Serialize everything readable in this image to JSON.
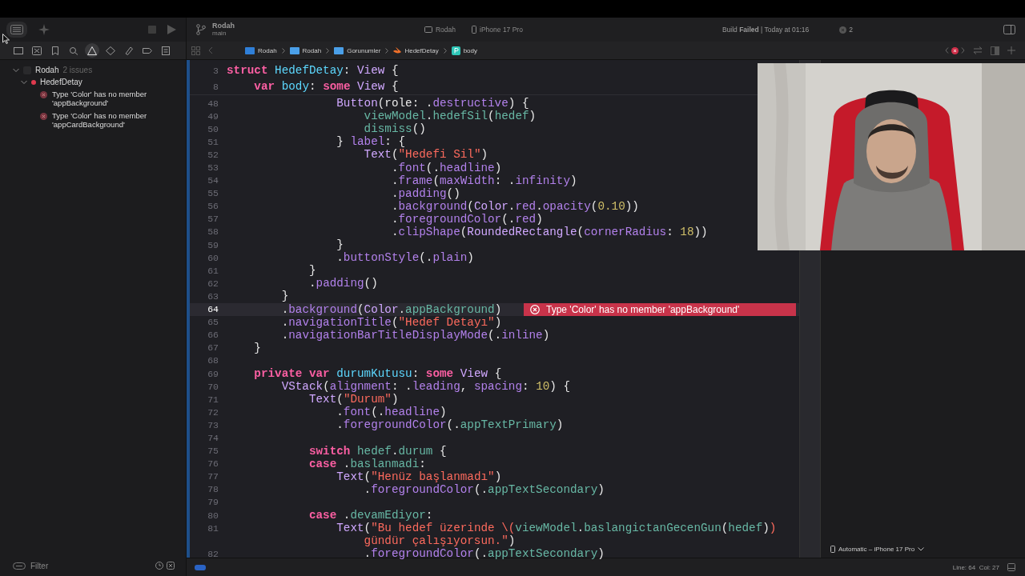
{
  "toolbar": {
    "project": "Rodah",
    "branch": "main",
    "scheme": "Rodah",
    "device": "iPhone 17 Pro",
    "status": "Build **Failed** | Today at 01:16",
    "issue_count": "2"
  },
  "navigator_tabs": [
    {
      "kind": "folder",
      "selected": false
    },
    {
      "kind": "source",
      "selected": false
    },
    {
      "kind": "bookmark",
      "selected": false
    },
    {
      "kind": "search",
      "selected": false
    },
    {
      "kind": "issue",
      "selected": true
    },
    {
      "kind": "test",
      "selected": false
    },
    {
      "kind": "debug",
      "selected": false
    },
    {
      "kind": "breakpoint",
      "selected": false
    },
    {
      "kind": "report",
      "selected": false
    }
  ],
  "navigator": {
    "project": "Rodah",
    "issues_label": "2 issues",
    "expanded": true,
    "files": [
      {
        "name": "HedefDetay",
        "expanded": true,
        "issues": [
          "Type 'Color' has no member 'appBackground'",
          "Type 'Color' has no member 'appCardBackground'"
        ]
      }
    ],
    "filter_placeholder": "Filter"
  },
  "jump_bar": [
    {
      "kind": "project",
      "label": "Rodah"
    },
    {
      "kind": "folder",
      "label": "Rodah"
    },
    {
      "kind": "folder",
      "label": "Gorunumler"
    },
    {
      "kind": "swift",
      "label": "HedefDetay"
    },
    {
      "kind": "property",
      "label": "body"
    }
  ],
  "editor": {
    "sticky_lines": [
      {
        "number": "3",
        "tokens": [
          {
            "kind": "keyword",
            "text": "struct"
          },
          {
            "kind": "decl",
            "text": " HedefDetay"
          },
          {
            "kind": "plain",
            "text": ": "
          },
          {
            "kind": "type",
            "text": "View"
          },
          {
            "kind": "plain",
            "text": " {"
          }
        ]
      },
      {
        "number": "8",
        "tokens": [
          {
            "kind": "keyword",
            "text": "    var"
          },
          {
            "kind": "decl",
            "text": " body"
          },
          {
            "kind": "plain",
            "text": ": "
          },
          {
            "kind": "keyword",
            "text": "some"
          },
          {
            "kind": "type",
            "text": " View"
          },
          {
            "kind": "plain",
            "text": " {"
          }
        ]
      }
    ],
    "lines": [
      {
        "number": "48",
        "current": false,
        "tokens": [
          {
            "kind": "type",
            "text": "                Button"
          },
          {
            "kind": "plain",
            "text": "(role: ."
          },
          {
            "kind": "call",
            "text": "destructive"
          },
          {
            "kind": "plain",
            "text": ") {"
          }
        ]
      },
      {
        "number": "49",
        "current": false,
        "tokens": [
          {
            "kind": "member",
            "text": "                    viewModel"
          },
          {
            "kind": "plain",
            "text": "."
          },
          {
            "kind": "member",
            "text": "hedefSil"
          },
          {
            "kind": "plain",
            "text": "("
          },
          {
            "kind": "member",
            "text": "hedef"
          },
          {
            "kind": "plain",
            "text": ")"
          }
        ]
      },
      {
        "number": "50",
        "current": false,
        "tokens": [
          {
            "kind": "member",
            "text": "                    dismiss"
          },
          {
            "kind": "plain",
            "text": "()"
          }
        ]
      },
      {
        "number": "51",
        "current": false,
        "tokens": [
          {
            "kind": "plain",
            "text": "                } "
          },
          {
            "kind": "call",
            "text": "label"
          },
          {
            "kind": "plain",
            "text": ": {"
          }
        ]
      },
      {
        "number": "52",
        "current": false,
        "tokens": [
          {
            "kind": "type",
            "text": "                    Text"
          },
          {
            "kind": "plain",
            "text": "("
          },
          {
            "kind": "string",
            "text": "\"Hedefi Sil\""
          },
          {
            "kind": "plain",
            "text": ")"
          }
        ]
      },
      {
        "number": "53",
        "current": false,
        "tokens": [
          {
            "kind": "plain",
            "text": "                        ."
          },
          {
            "kind": "call",
            "text": "font"
          },
          {
            "kind": "plain",
            "text": "(."
          },
          {
            "kind": "call",
            "text": "headline"
          },
          {
            "kind": "plain",
            "text": ")"
          }
        ]
      },
      {
        "number": "54",
        "current": false,
        "tokens": [
          {
            "kind": "plain",
            "text": "                        ."
          },
          {
            "kind": "call",
            "text": "frame"
          },
          {
            "kind": "plain",
            "text": "("
          },
          {
            "kind": "call",
            "text": "maxWidth"
          },
          {
            "kind": "plain",
            "text": ": ."
          },
          {
            "kind": "call",
            "text": "infinity"
          },
          {
            "kind": "plain",
            "text": ")"
          }
        ]
      },
      {
        "number": "55",
        "current": false,
        "tokens": [
          {
            "kind": "plain",
            "text": "                        ."
          },
          {
            "kind": "call",
            "text": "padding"
          },
          {
            "kind": "plain",
            "text": "()"
          }
        ]
      },
      {
        "number": "56",
        "current": false,
        "tokens": [
          {
            "kind": "plain",
            "text": "                        ."
          },
          {
            "kind": "call",
            "text": "background"
          },
          {
            "kind": "plain",
            "text": "("
          },
          {
            "kind": "type",
            "text": "Color"
          },
          {
            "kind": "plain",
            "text": "."
          },
          {
            "kind": "call",
            "text": "red"
          },
          {
            "kind": "plain",
            "text": "."
          },
          {
            "kind": "call",
            "text": "opacity"
          },
          {
            "kind": "plain",
            "text": "("
          },
          {
            "kind": "number",
            "text": "0.10"
          },
          {
            "kind": "plain",
            "text": "))"
          }
        ]
      },
      {
        "number": "57",
        "current": false,
        "tokens": [
          {
            "kind": "plain",
            "text": "                        ."
          },
          {
            "kind": "call",
            "text": "foregroundColor"
          },
          {
            "kind": "plain",
            "text": "(."
          },
          {
            "kind": "call",
            "text": "red"
          },
          {
            "kind": "plain",
            "text": ")"
          }
        ]
      },
      {
        "number": "58",
        "current": false,
        "tokens": [
          {
            "kind": "plain",
            "text": "                        ."
          },
          {
            "kind": "call",
            "text": "clipShape"
          },
          {
            "kind": "plain",
            "text": "("
          },
          {
            "kind": "type",
            "text": "RoundedRectangle"
          },
          {
            "kind": "plain",
            "text": "("
          },
          {
            "kind": "call",
            "text": "cornerRadius"
          },
          {
            "kind": "plain",
            "text": ": "
          },
          {
            "kind": "number",
            "text": "18"
          },
          {
            "kind": "plain",
            "text": "))"
          }
        ]
      },
      {
        "number": "59",
        "current": false,
        "tokens": [
          {
            "kind": "plain",
            "text": "                }"
          }
        ]
      },
      {
        "number": "60",
        "current": false,
        "tokens": [
          {
            "kind": "plain",
            "text": "                ."
          },
          {
            "kind": "call",
            "text": "buttonStyle"
          },
          {
            "kind": "plain",
            "text": "(."
          },
          {
            "kind": "call",
            "text": "plain"
          },
          {
            "kind": "plain",
            "text": ")"
          }
        ]
      },
      {
        "number": "61",
        "current": false,
        "tokens": [
          {
            "kind": "plain",
            "text": "            }"
          }
        ]
      },
      {
        "number": "62",
        "current": false,
        "tokens": [
          {
            "kind": "plain",
            "text": "            ."
          },
          {
            "kind": "call",
            "text": "padding"
          },
          {
            "kind": "plain",
            "text": "()"
          }
        ]
      },
      {
        "number": "63",
        "current": false,
        "tokens": [
          {
            "kind": "plain",
            "text": "        }"
          }
        ]
      },
      {
        "number": "64",
        "current": true,
        "error": "Type 'Color' has no member 'appBackground'",
        "tokens": [
          {
            "kind": "plain",
            "text": "        ."
          },
          {
            "kind": "call",
            "text": "background"
          },
          {
            "kind": "plain",
            "text": "("
          },
          {
            "kind": "type",
            "text": "Color"
          },
          {
            "kind": "plain",
            "text": "."
          },
          {
            "kind": "member",
            "text": "appBackground"
          },
          {
            "kind": "plain",
            "text": ")"
          }
        ]
      },
      {
        "number": "65",
        "current": false,
        "tokens": [
          {
            "kind": "plain",
            "text": "        ."
          },
          {
            "kind": "call",
            "text": "navigationTitle"
          },
          {
            "kind": "plain",
            "text": "("
          },
          {
            "kind": "string",
            "text": "\"Hedef Detayı\""
          },
          {
            "kind": "plain",
            "text": ")"
          }
        ]
      },
      {
        "number": "66",
        "current": false,
        "tokens": [
          {
            "kind": "plain",
            "text": "        ."
          },
          {
            "kind": "call",
            "text": "navigationBarTitleDisplayMode"
          },
          {
            "kind": "plain",
            "text": "(."
          },
          {
            "kind": "call",
            "text": "inline"
          },
          {
            "kind": "plain",
            "text": ")"
          }
        ]
      },
      {
        "number": "67",
        "current": false,
        "tokens": [
          {
            "kind": "plain",
            "text": "    }"
          }
        ]
      },
      {
        "number": "68",
        "current": false
      },
      {
        "number": "69",
        "current": false,
        "tokens": [
          {
            "kind": "keyword",
            "text": "    private"
          },
          {
            "kind": "keyword",
            "text": " var"
          },
          {
            "kind": "decl",
            "text": " durumKutusu"
          },
          {
            "kind": "plain",
            "text": ": "
          },
          {
            "kind": "keyword",
            "text": "some"
          },
          {
            "kind": "type",
            "text": " View"
          },
          {
            "kind": "plain",
            "text": " {"
          }
        ]
      },
      {
        "number": "70",
        "current": false,
        "tokens": [
          {
            "kind": "type",
            "text": "        VStack"
          },
          {
            "kind": "plain",
            "text": "("
          },
          {
            "kind": "call",
            "text": "alignment"
          },
          {
            "kind": "plain",
            "text": ": ."
          },
          {
            "kind": "call",
            "text": "leading"
          },
          {
            "kind": "plain",
            "text": ", "
          },
          {
            "kind": "call",
            "text": "spacing"
          },
          {
            "kind": "plain",
            "text": ": "
          },
          {
            "kind": "number",
            "text": "10"
          },
          {
            "kind": "plain",
            "text": ") {"
          }
        ]
      },
      {
        "number": "71",
        "current": false,
        "tokens": [
          {
            "kind": "type",
            "text": "            Text"
          },
          {
            "kind": "plain",
            "text": "("
          },
          {
            "kind": "string",
            "text": "\"Durum\""
          },
          {
            "kind": "plain",
            "text": ")"
          }
        ]
      },
      {
        "number": "72",
        "current": false,
        "tokens": [
          {
            "kind": "plain",
            "text": "                ."
          },
          {
            "kind": "call",
            "text": "font"
          },
          {
            "kind": "plain",
            "text": "(."
          },
          {
            "kind": "call",
            "text": "headline"
          },
          {
            "kind": "plain",
            "text": ")"
          }
        ]
      },
      {
        "number": "73",
        "current": false,
        "tokens": [
          {
            "kind": "plain",
            "text": "                ."
          },
          {
            "kind": "call",
            "text": "foregroundColor"
          },
          {
            "kind": "plain",
            "text": "(."
          },
          {
            "kind": "member",
            "text": "appTextPrimary"
          },
          {
            "kind": "plain",
            "text": ")"
          }
        ]
      },
      {
        "number": "74",
        "current": false
      },
      {
        "number": "75",
        "current": false,
        "tokens": [
          {
            "kind": "keyword",
            "text": "            switch"
          },
          {
            "kind": "member",
            "text": " hedef"
          },
          {
            "kind": "plain",
            "text": "."
          },
          {
            "kind": "member",
            "text": "durum"
          },
          {
            "kind": "plain",
            "text": " {"
          }
        ]
      },
      {
        "number": "76",
        "current": false,
        "tokens": [
          {
            "kind": "keyword",
            "text": "            case"
          },
          {
            "kind": "plain",
            "text": " ."
          },
          {
            "kind": "member",
            "text": "baslanmadi"
          },
          {
            "kind": "plain",
            "text": ":"
          }
        ]
      },
      {
        "number": "77",
        "current": false,
        "tokens": [
          {
            "kind": "type",
            "text": "                Text"
          },
          {
            "kind": "plain",
            "text": "("
          },
          {
            "kind": "string",
            "text": "\"Henüz başlanmadı\""
          },
          {
            "kind": "plain",
            "text": ")"
          }
        ]
      },
      {
        "number": "78",
        "current": false,
        "tokens": [
          {
            "kind": "plain",
            "text": "                    ."
          },
          {
            "kind": "call",
            "text": "foregroundColor"
          },
          {
            "kind": "plain",
            "text": "(."
          },
          {
            "kind": "member",
            "text": "appTextSecondary"
          },
          {
            "kind": "plain",
            "text": ")"
          }
        ]
      },
      {
        "number": "79",
        "current": false
      },
      {
        "number": "80",
        "current": false,
        "tokens": [
          {
            "kind": "keyword",
            "text": "            case"
          },
          {
            "kind": "plain",
            "text": " ."
          },
          {
            "kind": "member",
            "text": "devamEdiyor"
          },
          {
            "kind": "plain",
            "text": ":"
          }
        ]
      },
      {
        "number": "81",
        "current": false,
        "tokens": [
          {
            "kind": "type",
            "text": "                Text"
          },
          {
            "kind": "plain",
            "text": "("
          },
          {
            "kind": "string",
            "text": "\"Bu hedef üzerinde \\("
          },
          {
            "kind": "member",
            "text": "viewModel"
          },
          {
            "kind": "plain",
            "text": "."
          },
          {
            "kind": "member",
            "text": "baslangictanGecenGun"
          },
          {
            "kind": "plain",
            "text": "("
          },
          {
            "kind": "member",
            "text": "hedef"
          },
          {
            "kind": "plain",
            "text": ")"
          },
          {
            "kind": "string",
            "text": ")"
          }
        ],
        "wrap": [
          {
            "kind": "string",
            "text": "                    gündür çalışıyorsun.\""
          },
          {
            "kind": "plain",
            "text": ")"
          }
        ]
      },
      {
        "number": "82",
        "current": false,
        "tokens": [
          {
            "kind": "plain",
            "text": "                    ."
          },
          {
            "kind": "call",
            "text": "foregroundColor"
          },
          {
            "kind": "plain",
            "text": "(."
          },
          {
            "kind": "member",
            "text": "appTextSecondary"
          },
          {
            "kind": "plain",
            "text": ")"
          }
        ]
      }
    ]
  },
  "preview": {
    "device": "Automatic – iPhone 17 Pro"
  },
  "status_bar": {
    "position": "Line: 64  Col: 27"
  }
}
